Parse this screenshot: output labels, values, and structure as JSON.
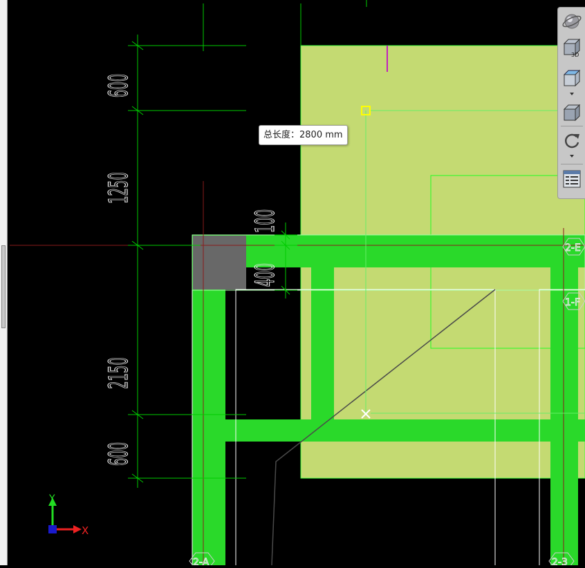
{
  "measurement_tooltip": "总长度：2800 mm",
  "dimensions": {
    "d1": "600",
    "d2": "1250",
    "d3": "2150",
    "d4": "600",
    "d5": "100",
    "d6": "400"
  },
  "axis_labels": {
    "top_right": "2-E",
    "right_mid": "1-F",
    "bottom_left": "2-A",
    "bottom_right": "2-3"
  },
  "ucs": {
    "x_label": "X",
    "y_label": "Y"
  },
  "toolbar": {
    "cube_3d_label": "3D",
    "buttons": [
      "orbit-icon",
      "view-3d-cube-icon",
      "view-top-icon",
      "view-side-icon",
      "rotate-icon",
      "properties-icon"
    ]
  },
  "colors": {
    "background": "#000000",
    "slab_fill": "#c4da72",
    "beam_fill": "#2ad92a",
    "column_fill": "#686868",
    "dimension_line": "#00cc00",
    "axis_line": "#8a1a1a",
    "selection_marker": "#ffff00"
  }
}
